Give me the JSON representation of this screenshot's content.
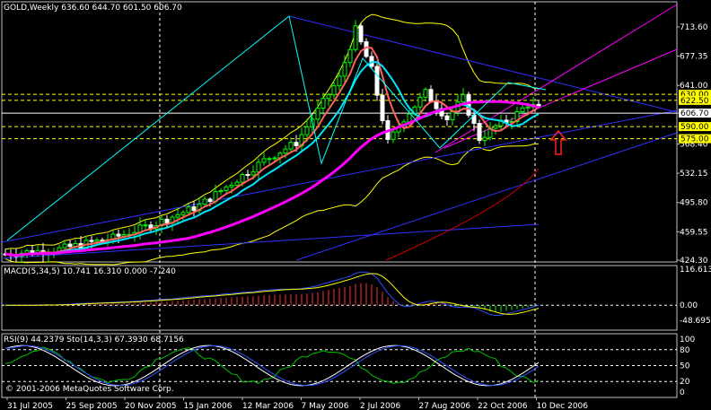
{
  "chart_data": {
    "type": "candlestick",
    "main": {
      "title": "GOLD,Weekly",
      "ohlc_text": "636.60 644.70 601.50 606.70",
      "y_ticks": [
        "713.60",
        "677.35",
        "641.00",
        "606.70",
        "568.40",
        "532.15",
        "495.80",
        "459.55",
        "424.30"
      ],
      "y_range": [
        424.3,
        713.6
      ],
      "price_tags": [
        {
          "value": "630.00",
          "color": "#ffff00",
          "y_value": 630.0
        },
        {
          "value": "622.50",
          "color": "#ffff00",
          "y_value": 622.5
        },
        {
          "value": "606.70",
          "color": "#ffffff",
          "y_value": 606.7
        },
        {
          "value": "590.00",
          "color": "#ffff00",
          "y_value": 590.0
        },
        {
          "value": "575.00",
          "color": "#ffff00",
          "y_value": 575.0
        }
      ]
    },
    "macd": {
      "title": "MACD(5,34,5) 10.741 16.310 0.000 -7.240",
      "y_ticks": [
        "116.613",
        "0.00",
        "-48.695"
      ],
      "y_range": [
        -48.695,
        116.613
      ]
    },
    "rsi": {
      "title": "RSI(9) 44.2379  Sto(14,3,3) 67.3930 68.7156",
      "y_ticks": [
        "100",
        "80",
        "50",
        "20",
        "0"
      ],
      "y_range": [
        0,
        100
      ]
    },
    "x_ticks": [
      "31 Jul 2005",
      "25 Sep 2005",
      "20 Nov 2005",
      "15 Jan 2006",
      "12 Mar 2006",
      "7 May 2006",
      "2 Jul 2006",
      "27 Aug 2006",
      "22 Oct 2006",
      "10 Dec 2006"
    ],
    "copyright": "© 2001-2006 MetaQuotes Software Corp.",
    "colors": {
      "bull": "#00ff00",
      "bear": "#ffffff",
      "ma_fast": "#ff6060",
      "ma_cyan": "#00e5ff",
      "ma_magenta": "#ff00ff",
      "ma_red": "#dd0000",
      "bands": "#ffff00",
      "trend_blue": "#3030ff",
      "trend_pink": "#ff00ff",
      "grid": "#ffffff"
    }
  }
}
